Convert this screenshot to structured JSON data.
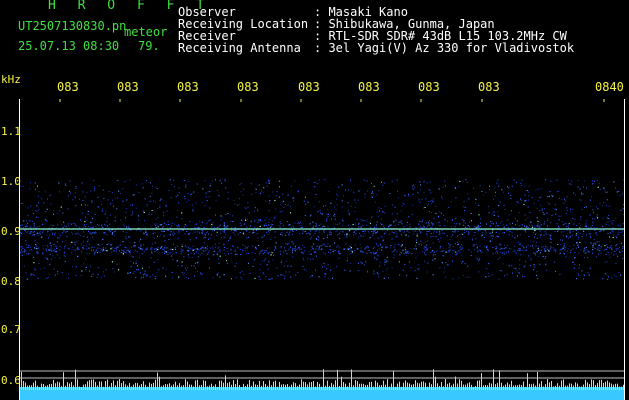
{
  "header": {
    "brand": "H R O F F T",
    "filename": "UT2507130830.pn",
    "tag": "meteor",
    "timestamp": "25.07.13 08:30",
    "count": "79."
  },
  "info": [
    {
      "label": "Observer",
      "value": ": Masaki Kano"
    },
    {
      "label": "Receiving Location",
      "value": ": Shibukawa, Gunma, Japan"
    },
    {
      "label": "Receiver",
      "value": ": RTL-SDR SDR# 43dB L15 103.2MHz CW"
    },
    {
      "label": "Receiving Antenna",
      "value": ": 3el Yagi(V) Az 330 for Vladivostok"
    }
  ],
  "axis": {
    "unit": "kHz",
    "y_labels": [
      "1.1",
      "1.0",
      "0.9",
      "0.8",
      "0.7",
      "0.6"
    ],
    "x_ticks": [
      "083",
      "083",
      "083",
      "083",
      "083",
      "083",
      "083",
      "083",
      "0840"
    ]
  },
  "colors": {
    "background": "#000000",
    "text_header": "#3fe03f",
    "text_info": "#ffffff",
    "axis_text": "#f5f542",
    "echo_band": "#2a55ff",
    "carrier": "#7fe0c0",
    "noise_floor": "#39c8ff"
  },
  "spectrum": {
    "band_top_khz": 1.0,
    "band_bottom_khz": 0.8,
    "carrier_khz": 0.9,
    "secondary_khz": 0.86
  }
}
